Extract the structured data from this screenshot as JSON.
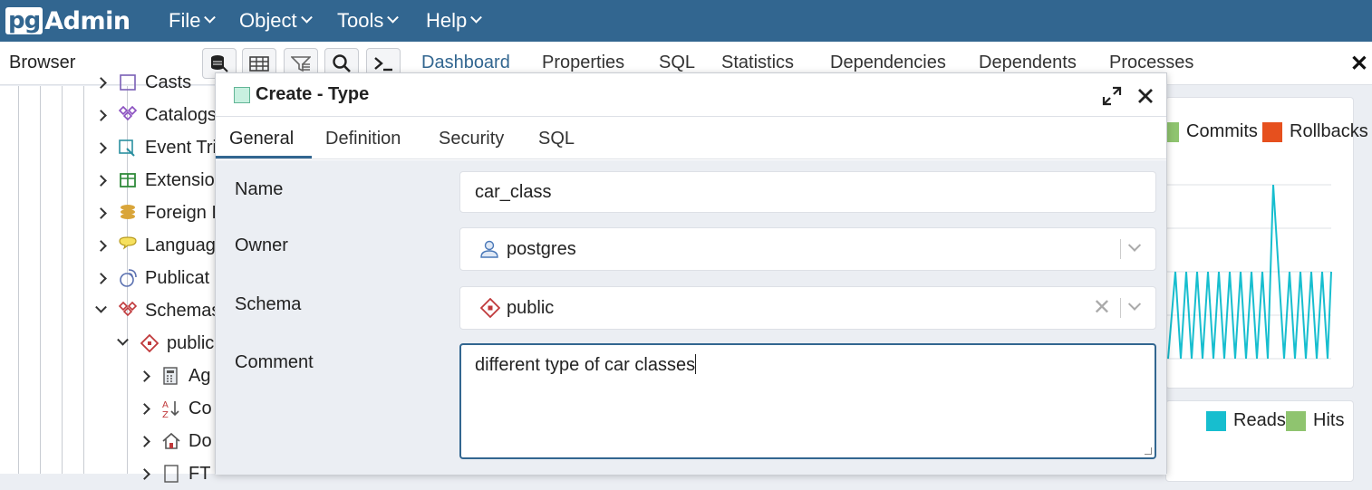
{
  "app": {
    "logo_pg": "pg",
    "logo_admin": "Admin"
  },
  "menu": {
    "items": [
      {
        "label": "File"
      },
      {
        "label": "Object"
      },
      {
        "label": "Tools"
      },
      {
        "label": "Help"
      }
    ]
  },
  "browser": {
    "title": "Browser",
    "toolbar_icons": [
      "query-tool-icon",
      "table-view-icon",
      "filter-rows-icon",
      "search-icon",
      "psql-terminal-icon"
    ]
  },
  "main_tabs": [
    "Dashboard",
    "Properties",
    "SQL",
    "Statistics",
    "Dependencies",
    "Dependents",
    "Processes"
  ],
  "tree": {
    "items": [
      {
        "label": "Casts",
        "icon": "casts-icon"
      },
      {
        "label": "Catalogs",
        "icon": "catalogs-icon"
      },
      {
        "label": "Event Tri",
        "icon": "event-trigger-icon"
      },
      {
        "label": "Extensio",
        "icon": "extension-icon"
      },
      {
        "label": "Foreign I",
        "icon": "foreign-data-wrapper-icon"
      },
      {
        "label": "Languag",
        "icon": "language-icon"
      },
      {
        "label": "Publicat",
        "icon": "publication-icon"
      },
      {
        "label": "Schemas",
        "icon": "schemas-icon"
      },
      {
        "label": "public",
        "icon": "schema-icon"
      },
      {
        "label": "Ag",
        "icon": "aggregate-icon"
      },
      {
        "label": "Co",
        "icon": "collation-icon"
      },
      {
        "label": "Do",
        "icon": "domain-icon"
      },
      {
        "label": "FT",
        "icon": "fts-icon"
      }
    ]
  },
  "dashboard": {
    "legend_top": [
      {
        "label": "Commits",
        "color": "#8fc46f"
      },
      {
        "label": "Rollbacks",
        "color": "#e6501e"
      }
    ],
    "legend_bottom": [
      {
        "label": "Reads",
        "color": "#17becf"
      },
      {
        "label": "Hits",
        "color": "#8fc46f"
      }
    ],
    "line_color": "#17becf"
  },
  "dialog": {
    "title": "Create - Type",
    "tabs": [
      "General",
      "Definition",
      "Security",
      "SQL"
    ],
    "active_tab": "General",
    "fields": {
      "name_label": "Name",
      "name_value": "car_class",
      "owner_label": "Owner",
      "owner_value": "postgres",
      "schema_label": "Schema",
      "schema_value": "public",
      "comment_label": "Comment",
      "comment_value": "different type of car classes"
    }
  }
}
